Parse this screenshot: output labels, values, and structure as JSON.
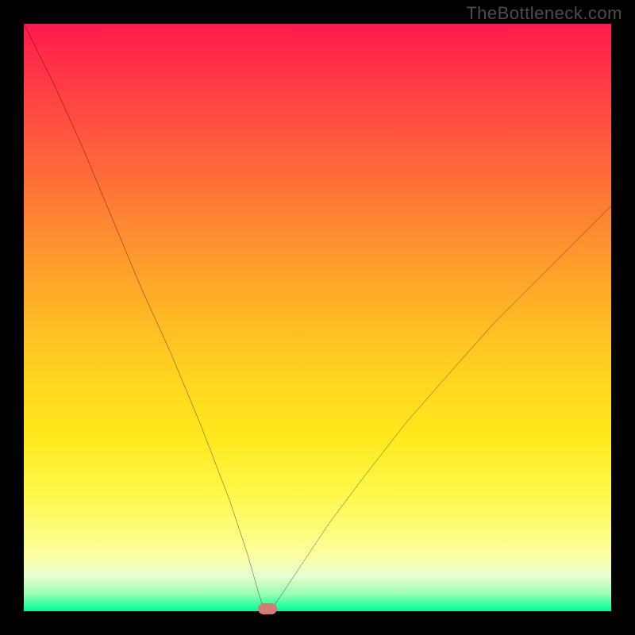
{
  "watermark": "TheBottleneck.com",
  "chart_data": {
    "type": "line",
    "title": "",
    "xlabel": "",
    "ylabel": "",
    "xlim": [
      0,
      100
    ],
    "ylim": [
      0,
      100
    ],
    "grid": false,
    "legend": null,
    "series": [
      {
        "name": "bottleneck-curve",
        "x": [
          0,
          5,
          10,
          15,
          20,
          25,
          30,
          35,
          38,
          40,
          41,
          42,
          44,
          48,
          52,
          58,
          65,
          72,
          80,
          88,
          95,
          100
        ],
        "values": [
          100,
          90,
          79,
          67,
          55,
          44,
          32,
          19,
          10,
          3,
          0,
          0,
          3,
          9,
          15,
          23,
          32,
          40,
          49,
          57,
          64,
          69
        ]
      }
    ],
    "marker": {
      "x": 41.5,
      "y": 0
    },
    "colors": {
      "curve": "#000000",
      "marker": "#d47a78",
      "gradient_top": "#ff1a4d",
      "gradient_bottom": "#00f5a0"
    }
  }
}
